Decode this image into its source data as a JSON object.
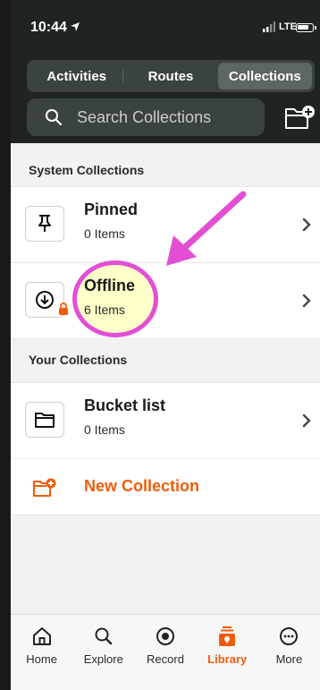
{
  "status_bar": {
    "time": "10:44",
    "network": "LTE"
  },
  "segments": [
    {
      "label": "Activities",
      "active": false
    },
    {
      "label": "Routes",
      "active": false
    },
    {
      "label": "Collections",
      "active": true
    }
  ],
  "search": {
    "placeholder": "Search Collections",
    "icon": "search-icon",
    "action_icon": "new-folder-icon"
  },
  "system_collections": {
    "title": "System Collections",
    "items": [
      {
        "name": "Pinned",
        "count": "0 Items",
        "icon": "pin-icon"
      },
      {
        "name": "Offline",
        "count": "6 Items",
        "icon": "download-icon"
      }
    ]
  },
  "your_collections": {
    "title": "Your Collections",
    "items": [
      {
        "name": "Bucket list",
        "count": "0 Items",
        "icon": "folder-icon"
      }
    ],
    "new_label": "New Collection"
  },
  "tabbar": [
    {
      "label": "Home",
      "icon": "home-icon",
      "active": false
    },
    {
      "label": "Explore",
      "icon": "search-icon",
      "active": false
    },
    {
      "label": "Record",
      "icon": "record-icon",
      "active": false
    },
    {
      "label": "Library",
      "icon": "library-icon",
      "active": true
    },
    {
      "label": "More",
      "icon": "more-icon",
      "active": false
    }
  ],
  "colors": {
    "accent": "#f05c0a",
    "header": "#1e2424",
    "annotation_circle": "#e24fd4",
    "annotation_fill": "#ffffbe"
  }
}
